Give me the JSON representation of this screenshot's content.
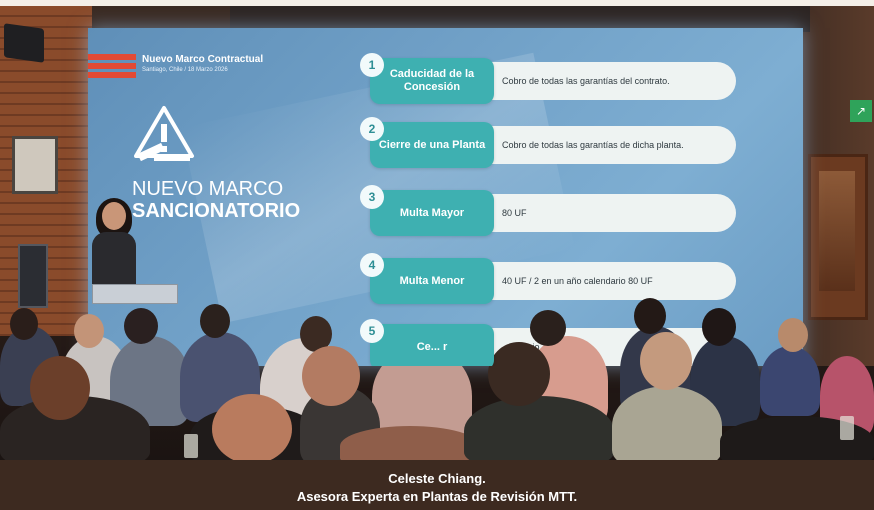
{
  "slide": {
    "header_title": "Nuevo Marco Contractual",
    "header_subtitle": "Santiago, Chile / 18 Marzo 2026",
    "title_line1": "NUEVO MARCO",
    "title_line2": "SANCIONATORIO",
    "items": [
      {
        "number": "1",
        "label": "Caducidad de la Concesión",
        "description": "Cobro de todas las garantías del contrato."
      },
      {
        "number": "2",
        "label": "Cierre de una Planta",
        "description": "Cobro de todas las garantías de dicha planta."
      },
      {
        "number": "3",
        "label": "Multa Mayor",
        "description": "80 UF"
      },
      {
        "number": "4",
        "label": "Multa Menor",
        "description": "40 UF / 2 en un año calendario 80 UF"
      },
      {
        "number": "5",
        "label": "Ce... r",
        "description": "...endario"
      }
    ],
    "accent_color": "#3eb0b1",
    "logo_color": "#e24a35",
    "icons": [
      "warning-gavel-icon"
    ]
  },
  "caption": {
    "line1": "Celeste Chiang.",
    "line2": "Asesora Experta en Plantas de Revisión MTT."
  }
}
